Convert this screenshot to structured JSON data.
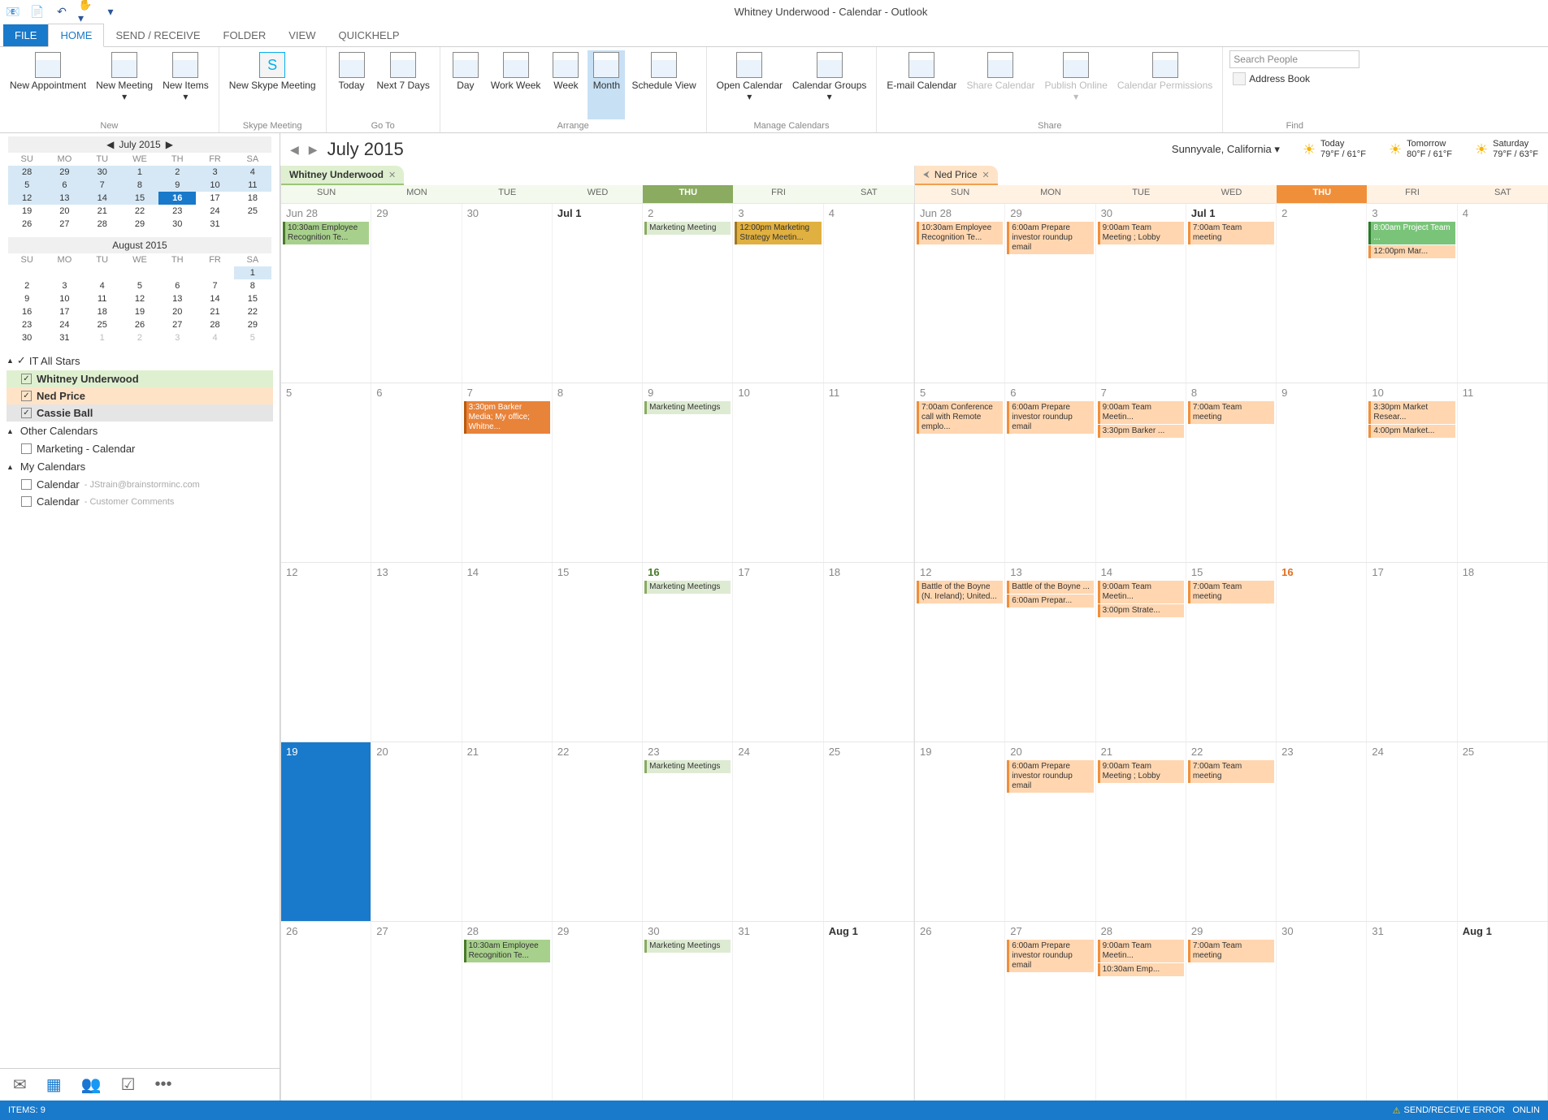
{
  "title": "Whitney Underwood - Calendar - Outlook",
  "tabs": {
    "file": "FILE",
    "home": "HOME",
    "sendreceive": "SEND / RECEIVE",
    "folder": "FOLDER",
    "view": "VIEW",
    "quickhelp": "QUICKHELP"
  },
  "ribbon": {
    "new": {
      "label": "New",
      "appt": "New Appointment",
      "meeting": "New Meeting",
      "items": "New Items"
    },
    "skype": {
      "label": "Skype Meeting",
      "btn": "New Skype Meeting"
    },
    "goto": {
      "label": "Go To",
      "today": "Today",
      "next7": "Next 7 Days"
    },
    "arrange": {
      "label": "Arrange",
      "day": "Day",
      "workweek": "Work Week",
      "week": "Week",
      "month": "Month",
      "schedule": "Schedule View"
    },
    "manage": {
      "label": "Manage Calendars",
      "open": "Open Calendar",
      "groups": "Calendar Groups"
    },
    "share": {
      "label": "Share",
      "email": "E-mail Calendar",
      "sharecal": "Share Calendar",
      "publish": "Publish Online",
      "perms": "Calendar Permissions"
    },
    "find": {
      "label": "Find",
      "search_ph": "Search People",
      "addr": "Address Book"
    }
  },
  "minical1": {
    "title": "July 2015",
    "dow": [
      "SU",
      "MO",
      "TU",
      "WE",
      "TH",
      "FR",
      "SA"
    ],
    "rows": [
      [
        "28",
        "29",
        "30",
        "1",
        "2",
        "3",
        "4"
      ],
      [
        "5",
        "6",
        "7",
        "8",
        "9",
        "10",
        "11"
      ],
      [
        "12",
        "13",
        "14",
        "15",
        "16",
        "17",
        "18"
      ],
      [
        "19",
        "20",
        "21",
        "22",
        "23",
        "24",
        "25"
      ],
      [
        "26",
        "27",
        "28",
        "29",
        "30",
        "31",
        ""
      ]
    ]
  },
  "minical2": {
    "title": "August 2015",
    "dow": [
      "SU",
      "MO",
      "TU",
      "WE",
      "TH",
      "FR",
      "SA"
    ],
    "rows": [
      [
        "",
        "",
        "",
        "",
        "",
        "",
        "1"
      ],
      [
        "2",
        "3",
        "4",
        "5",
        "6",
        "7",
        "8"
      ],
      [
        "9",
        "10",
        "11",
        "12",
        "13",
        "14",
        "15"
      ],
      [
        "16",
        "17",
        "18",
        "19",
        "20",
        "21",
        "22"
      ],
      [
        "23",
        "24",
        "25",
        "26",
        "27",
        "28",
        "29"
      ],
      [
        "30",
        "31",
        "1",
        "2",
        "3",
        "4",
        "5"
      ]
    ]
  },
  "groups": {
    "g1": {
      "name": "IT All Stars",
      "items": [
        "Whitney Underwood",
        "Ned Price",
        "Cassie Ball"
      ]
    },
    "g2": {
      "name": "Other Calendars",
      "items": [
        "Marketing - Calendar"
      ]
    },
    "g3": {
      "name": "My Calendars",
      "items": [
        {
          "name": "Calendar",
          "sub": "- JStrain@brainstorminc.com"
        },
        {
          "name": "Calendar",
          "sub": "- Customer Comments"
        }
      ]
    }
  },
  "calhdr": {
    "month": "July 2015",
    "loc": "Sunnyvale, California",
    "wx": [
      {
        "label": "Today",
        "temp": "79°F / 61°F"
      },
      {
        "label": "Tomorrow",
        "temp": "80°F / 61°F"
      },
      {
        "label": "Saturday",
        "temp": "79°F / 63°F"
      }
    ]
  },
  "gridW": {
    "tab": "Whitney Underwood",
    "dow": [
      "SUN",
      "MON",
      "TUE",
      "WED",
      "THU",
      "FRI",
      "SAT"
    ],
    "weeks": [
      {
        "nums": [
          "Jun 28",
          "29",
          "30",
          "Jul 1",
          "2",
          "3",
          "4"
        ],
        "ev": [
          [
            "10:30am Employee Recognition Te..."
          ],
          [],
          [],
          [],
          [
            "Marketing Meeting"
          ],
          [
            "12:00pm Marketing Strategy Meetin..."
          ],
          []
        ]
      },
      {
        "nums": [
          "5",
          "6",
          "7",
          "8",
          "9",
          "10",
          "11"
        ],
        "ev": [
          [],
          [],
          [
            "3:30pm Barker Media; My office; Whitne..."
          ],
          [],
          [
            "Marketing Meetings"
          ],
          [],
          []
        ]
      },
      {
        "nums": [
          "12",
          "13",
          "14",
          "15",
          "16",
          "17",
          "18"
        ],
        "ev": [
          [],
          [],
          [],
          [],
          [
            "Marketing Meetings"
          ],
          [],
          []
        ]
      },
      {
        "nums": [
          "19",
          "20",
          "21",
          "22",
          "23",
          "24",
          "25"
        ],
        "ev": [
          [],
          [],
          [],
          [],
          [
            "Marketing Meetings"
          ],
          [],
          []
        ]
      },
      {
        "nums": [
          "26",
          "27",
          "28",
          "29",
          "30",
          "31",
          "Aug 1"
        ],
        "ev": [
          [],
          [],
          [
            "10:30am Employee Recognition Te..."
          ],
          [],
          [
            "Marketing Meetings"
          ],
          [],
          []
        ]
      }
    ]
  },
  "gridN": {
    "tab": "Ned Price",
    "dow": [
      "SUN",
      "MON",
      "TUE",
      "WED",
      "THU",
      "FRI",
      "SAT"
    ],
    "weeks": [
      {
        "nums": [
          "Jun 28",
          "29",
          "30",
          "Jul 1",
          "2",
          "3",
          "4"
        ],
        "ev": [
          [
            "10:30am Employee Recognition Te..."
          ],
          [
            "6:00am Prepare investor roundup email"
          ],
          [
            "9:00am Team Meeting ; Lobby"
          ],
          [
            "7:00am Team meeting"
          ],
          [],
          [
            "8:00am Project Team ...",
            "12:00pm Mar..."
          ],
          []
        ]
      },
      {
        "nums": [
          "5",
          "6",
          "7",
          "8",
          "9",
          "10",
          "11"
        ],
        "ev": [
          [
            "7:00am Conference call with Remote emplo..."
          ],
          [
            "6:00am Prepare investor roundup email"
          ],
          [
            "9:00am Team Meetin...",
            "3:30pm Barker ..."
          ],
          [
            "7:00am Team meeting"
          ],
          [],
          [
            "3:30pm Market Resear...",
            "4:00pm Market..."
          ],
          []
        ]
      },
      {
        "nums": [
          "12",
          "13",
          "14",
          "15",
          "16",
          "17",
          "18"
        ],
        "ev": [
          [
            "Battle of the Boyne (N. Ireland); United..."
          ],
          [
            "Battle of the Boyne ...",
            "6:00am Prepar..."
          ],
          [
            "9:00am Team Meetin...",
            "3:00pm Strate..."
          ],
          [
            "7:00am Team meeting"
          ],
          [],
          [],
          []
        ]
      },
      {
        "nums": [
          "19",
          "20",
          "21",
          "22",
          "23",
          "24",
          "25"
        ],
        "ev": [
          [],
          [
            "6:00am Prepare investor roundup email"
          ],
          [
            "9:00am Team Meeting ; Lobby"
          ],
          [
            "7:00am Team meeting"
          ],
          [],
          [],
          []
        ]
      },
      {
        "nums": [
          "26",
          "27",
          "28",
          "29",
          "30",
          "31",
          "Aug 1"
        ],
        "ev": [
          [],
          [
            "6:00am Prepare investor roundup email"
          ],
          [
            "9:00am Team Meetin...",
            "10:30am Emp..."
          ],
          [
            "7:00am Team meeting"
          ],
          [],
          [],
          []
        ]
      }
    ]
  },
  "status": {
    "items": "ITEMS: 9",
    "err": "SEND/RECEIVE ERROR",
    "online": "ONLIN"
  }
}
